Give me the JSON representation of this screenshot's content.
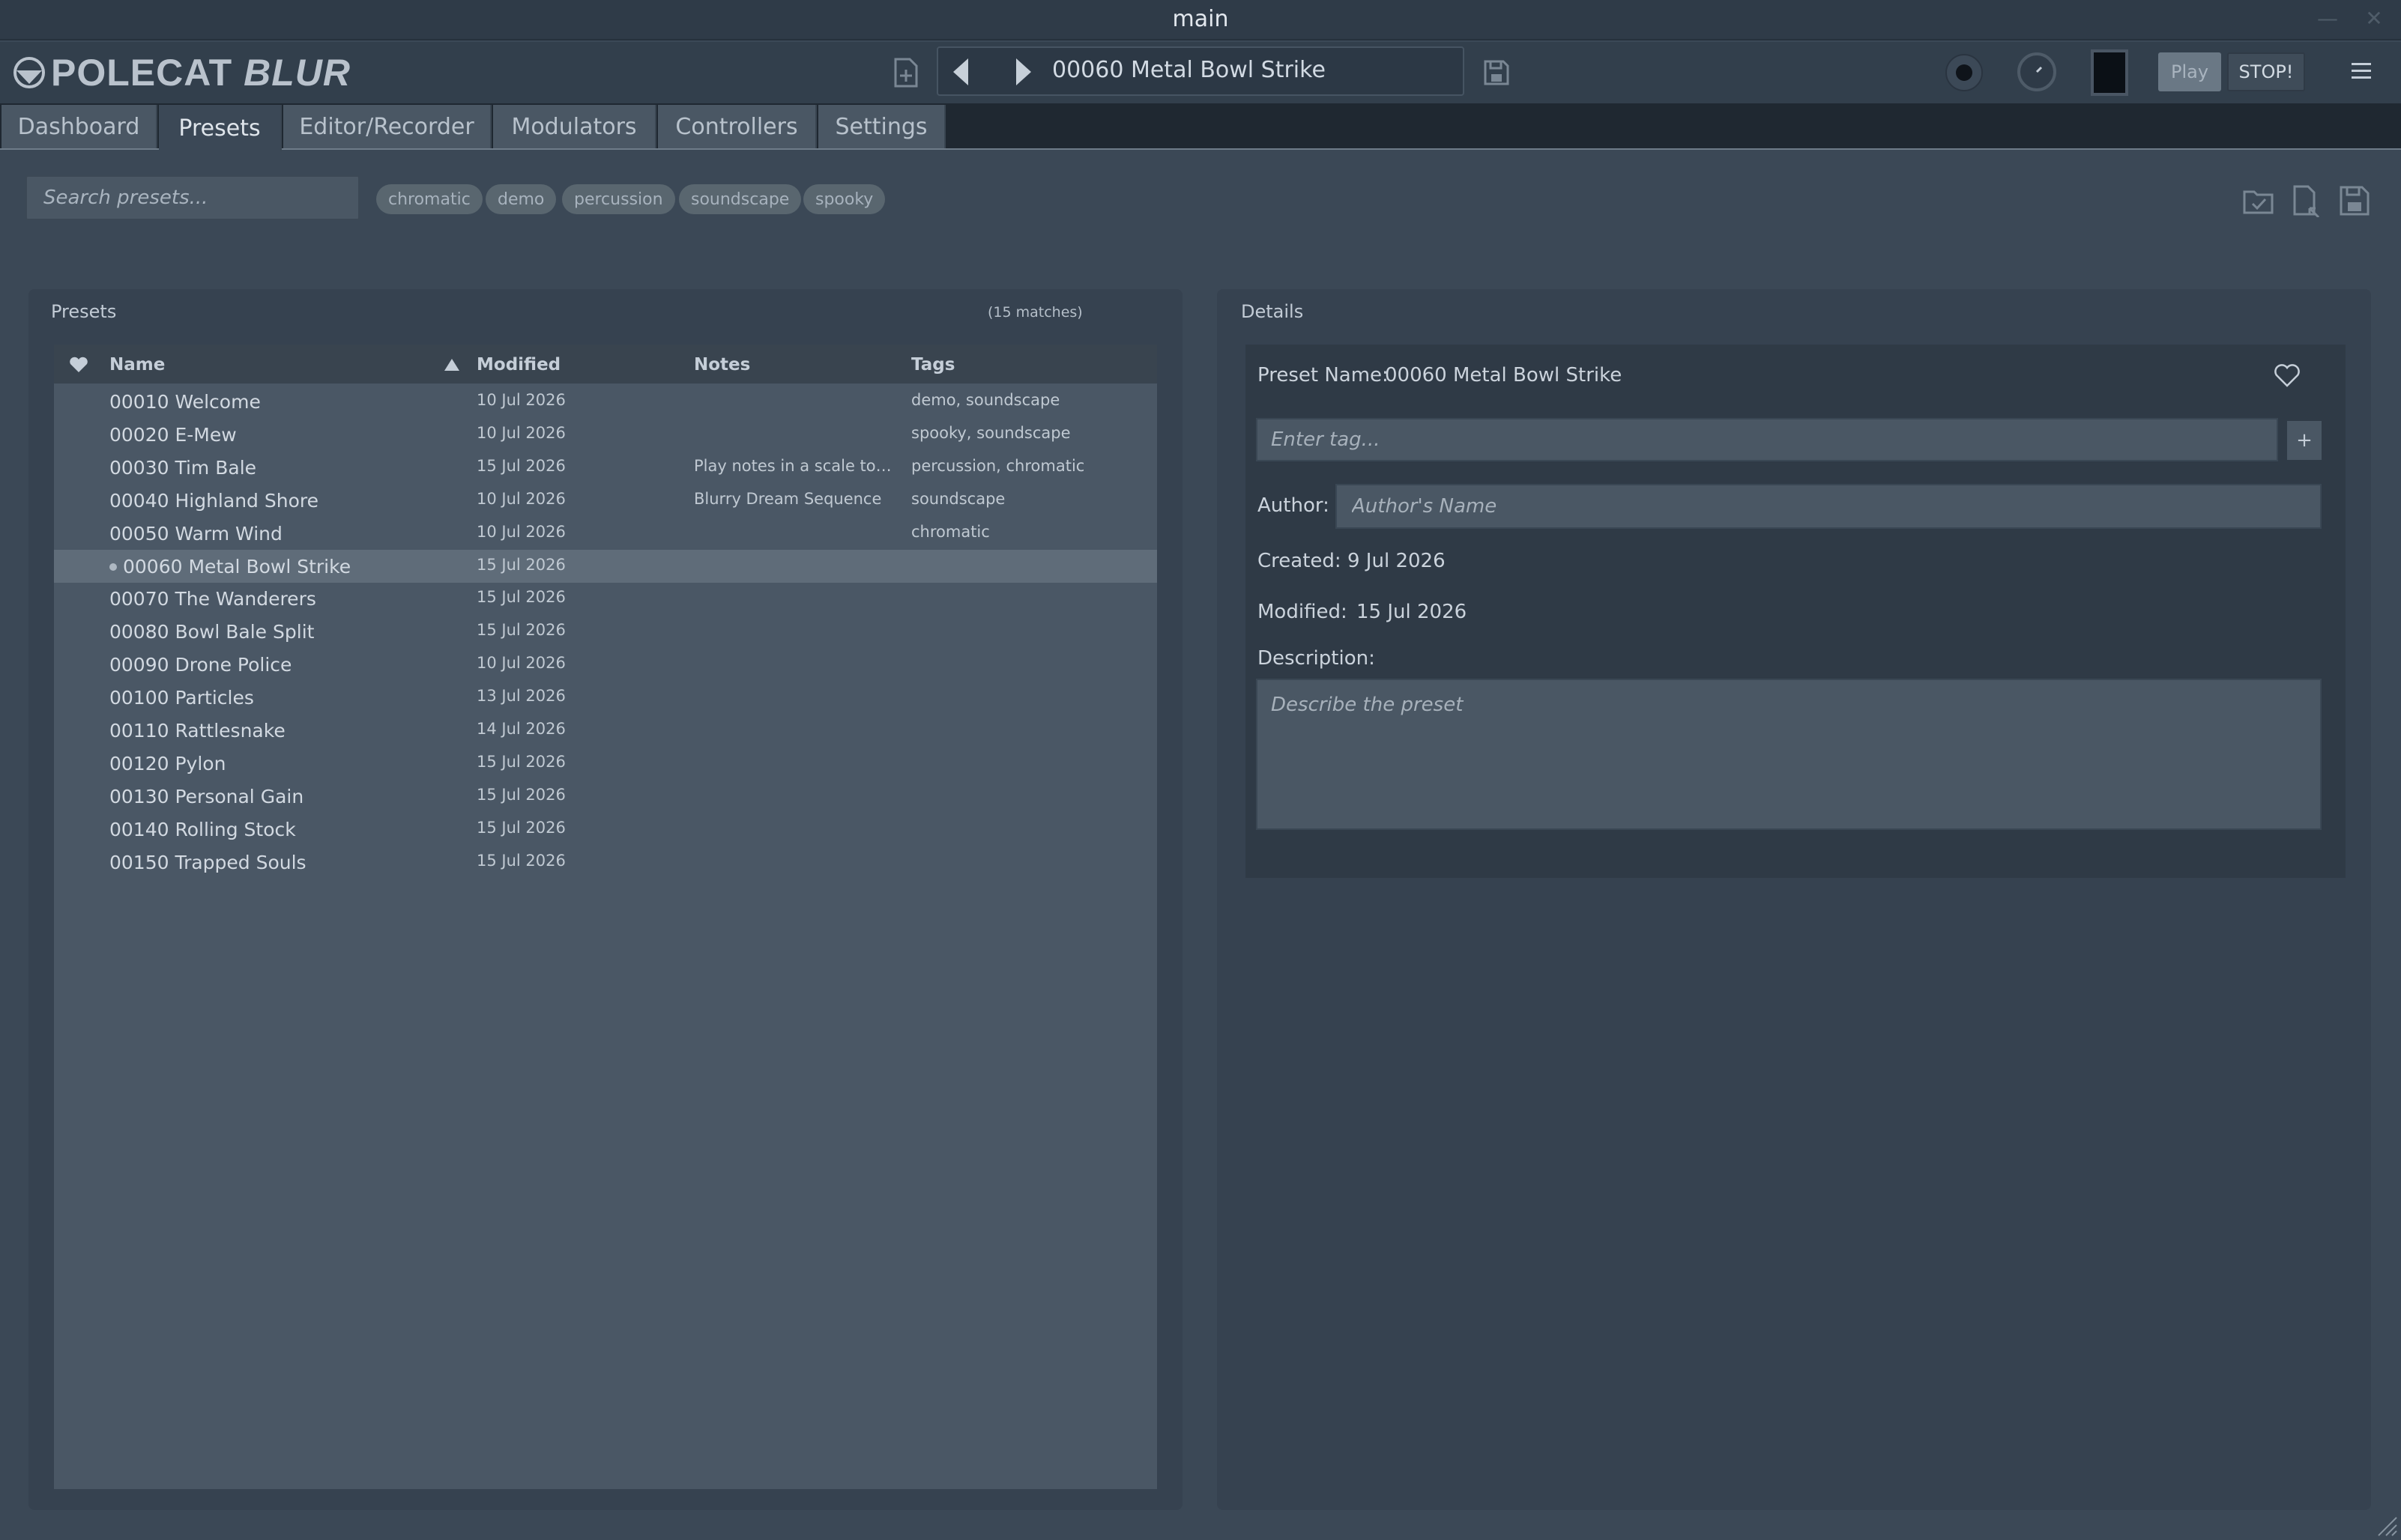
{
  "window": {
    "title": "main"
  },
  "app": {
    "brand": "POLECAT",
    "brand_suffix": "BLUR",
    "current_preset": "00060 Metal Bowl Strike",
    "play_label": "Play",
    "stop_label": "STOP!"
  },
  "tabs": [
    {
      "label": "Dashboard"
    },
    {
      "label": "Presets"
    },
    {
      "label": "Editor/Recorder"
    },
    {
      "label": "Modulators"
    },
    {
      "label": "Controllers"
    },
    {
      "label": "Settings"
    }
  ],
  "active_tab": "Presets",
  "search": {
    "placeholder": "Search presets...",
    "value": ""
  },
  "tag_filters": [
    "chromatic",
    "demo",
    "percussion",
    "soundscape",
    "spooky"
  ],
  "presets_panel": {
    "title": "Presets",
    "match_count": "(15 matches)",
    "columns": {
      "name": "Name",
      "modified": "Modified",
      "notes": "Notes",
      "tags": "Tags"
    },
    "rows": [
      {
        "name": "00010 Welcome",
        "modified": "10 Jul 2026",
        "notes": "",
        "tags": "demo, soundscape"
      },
      {
        "name": "00020 E-Mew",
        "modified": "10 Jul 2026",
        "notes": "",
        "tags": "spooky, soundscape"
      },
      {
        "name": "00030 Tim Bale",
        "modified": "15 Jul 2026",
        "notes": "Play notes in a scale to h...",
        "tags": "percussion, chromatic"
      },
      {
        "name": "00040 Highland Shore",
        "modified": "10 Jul 2026",
        "notes": "Blurry Dream Sequence",
        "tags": "soundscape"
      },
      {
        "name": "00050 Warm Wind",
        "modified": "10 Jul 2026",
        "notes": "",
        "tags": "chromatic"
      },
      {
        "name": "00060 Metal Bowl Strike",
        "modified": "15 Jul 2026",
        "notes": "",
        "tags": "",
        "selected": true
      },
      {
        "name": "00070 The Wanderers",
        "modified": "15 Jul 2026",
        "notes": "",
        "tags": ""
      },
      {
        "name": "00080 Bowl Bale Split",
        "modified": "15 Jul 2026",
        "notes": "",
        "tags": ""
      },
      {
        "name": "00090 Drone Police",
        "modified": "10 Jul 2026",
        "notes": "",
        "tags": ""
      },
      {
        "name": "00100 Particles",
        "modified": "13 Jul 2026",
        "notes": "",
        "tags": ""
      },
      {
        "name": "00110 Rattlesnake",
        "modified": "14 Jul 2026",
        "notes": "",
        "tags": ""
      },
      {
        "name": "00120 Pylon",
        "modified": "15 Jul 2026",
        "notes": "",
        "tags": ""
      },
      {
        "name": "00130 Personal Gain",
        "modified": "15 Jul 2026",
        "notes": "",
        "tags": ""
      },
      {
        "name": "00140 Rolling Stock",
        "modified": "15 Jul 2026",
        "notes": "",
        "tags": ""
      },
      {
        "name": "00150 Trapped Souls",
        "modified": "15 Jul 2026",
        "notes": "",
        "tags": ""
      }
    ]
  },
  "details": {
    "title": "Details",
    "preset_name_label": "Preset Name:",
    "preset_name": "00060 Metal Bowl Strike",
    "tag_placeholder": "Enter tag...",
    "add_tag_label": "+",
    "author_label": "Author:",
    "author_placeholder": "Author's Name",
    "created_label": "Created:",
    "created": "9 Jul 2026",
    "modified_label": "Modified:",
    "modified": "15 Jul 2026",
    "description_label": "Description:",
    "description_placeholder": "Describe the preset"
  },
  "icons": {
    "logo": "polecat-logo-icon",
    "new": "new-file-icon",
    "prev": "prev-arrow-icon",
    "next": "next-arrow-icon",
    "save": "save-icon",
    "menu": "hamburger-menu-icon",
    "favorite": "heart-icon",
    "sort": "sort-ascending-icon"
  }
}
